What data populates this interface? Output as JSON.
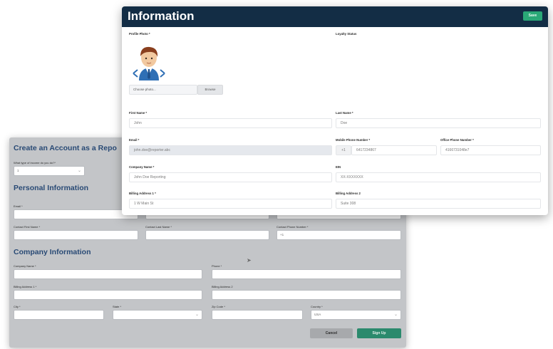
{
  "colors": {
    "header": "#132d45",
    "save": "#2aa877",
    "section_title": "#294a75",
    "signup": "#2b8a6d"
  },
  "signup_form": {
    "title": "Create an Account as a Repo",
    "income_label": "What type of income do you do?*",
    "income_value": "1",
    "personal_section": "Personal Information",
    "email_label": "Email *",
    "contact_first_label": "Contact First Name *",
    "contact_last_label": "Contact Last Name *",
    "contact_phone_label": "Contact Phone Number *",
    "contact_phone_prefix": "+1",
    "company_section": "Company Information",
    "company_name_label": "Company Name *",
    "phone_label": "Phone *",
    "billing1_label": "Billing Address 1 *",
    "billing2_label": "Billing Address 2",
    "city_label": "City *",
    "state_label": "State *",
    "zip_label": "Zip Code *",
    "country_label": "Country *",
    "country_value": "USA",
    "cancel_label": "Cancel",
    "signup_label": "Sign Up"
  },
  "info_panel": {
    "title": "Information",
    "save_label": "Save",
    "profile_photo_label": "Profile Photo *",
    "loyalty_status_label": "Loyalty Status",
    "choose_photo": "Choose photo...",
    "browse": "Browse",
    "first_name_label": "First Name *",
    "first_name_value": "John",
    "last_name_label": "Last Name *",
    "last_name_value": "Doe",
    "email_label": "Email *",
    "email_value": "john.doe@reporter.abc",
    "mobile_label": "Mobile Phone Number *",
    "mobile_prefix": "+1",
    "mobile_value": "6417234867",
    "office_label": "Office Phone Number *",
    "office_value": "4166731048e7",
    "company_label": "Company Name *",
    "company_value": "John Doe Reporting",
    "ein_label": "EIN",
    "ein_value": "XX-XXXXXXX",
    "billing1_label": "Billing Address 1 *",
    "billing1_value": "1 W Main St",
    "billing2_label": "Billing Address 2",
    "billing2_value": "Suite 308"
  }
}
